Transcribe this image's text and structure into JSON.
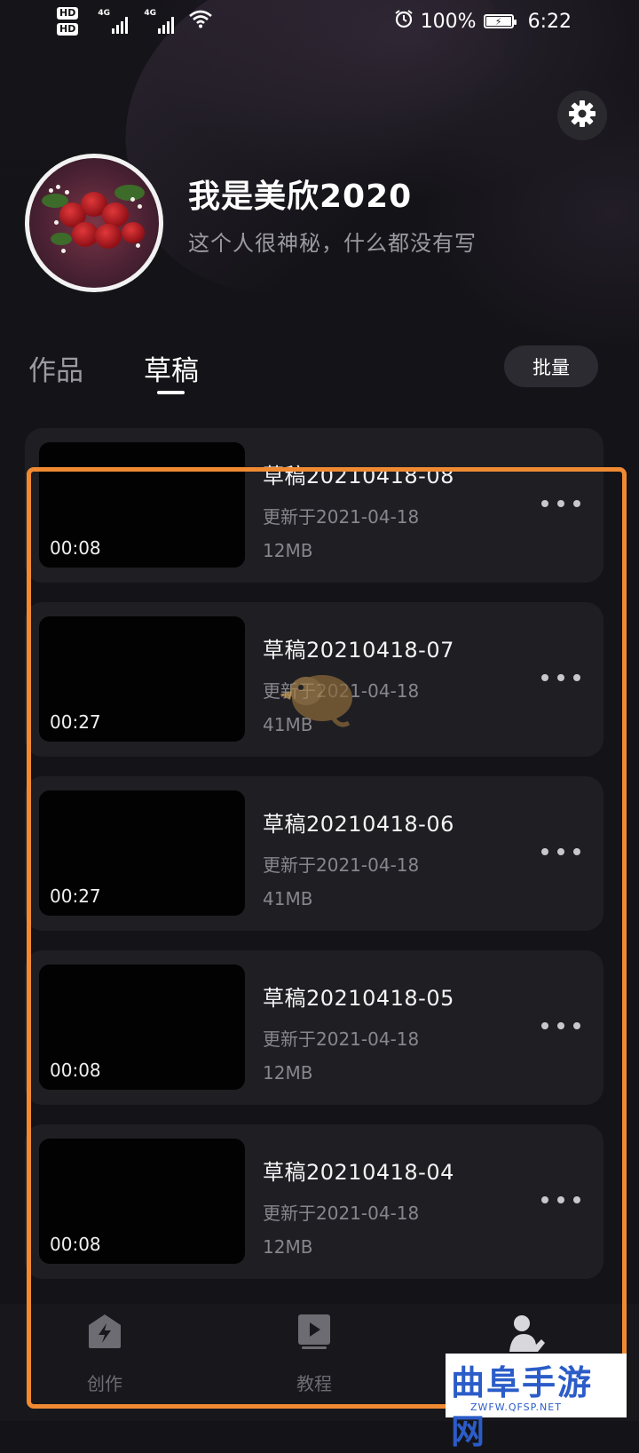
{
  "status_bar": {
    "hd1": "HD",
    "hd2": "HD",
    "net1": "4G",
    "net2": "4G",
    "battery_text": "100%",
    "time": "6:22"
  },
  "profile": {
    "username": "我是美欣2020",
    "bio": "这个人很神秘，什么都没有写"
  },
  "tabs": [
    {
      "label": "作品",
      "active": false
    },
    {
      "label": "草稿",
      "active": true
    }
  ],
  "batch_label": "批量",
  "drafts": [
    {
      "title": "草稿20210418-08",
      "updated": "更新于2021-04-18",
      "size": "12MB",
      "duration": "00:08"
    },
    {
      "title": "草稿20210418-07",
      "updated": "更新于2021-04-18",
      "size": "41MB",
      "duration": "00:27"
    },
    {
      "title": "草稿20210418-06",
      "updated": "更新于2021-04-18",
      "size": "41MB",
      "duration": "00:27"
    },
    {
      "title": "草稿20210418-05",
      "updated": "更新于2021-04-18",
      "size": "12MB",
      "duration": "00:08"
    },
    {
      "title": "草稿20210418-04",
      "updated": "更新于2021-04-18",
      "size": "12MB",
      "duration": "00:08"
    }
  ],
  "nav": {
    "create": "创作",
    "tutorial": "教程"
  },
  "watermark": {
    "main": "曲阜手游网",
    "sub": "ZWFW.QFSP.NET"
  },
  "colors": {
    "background": "#141418",
    "card": "#1e1e23",
    "highlight": "#f08a32",
    "muted_text": "#86868c"
  },
  "icons": [
    "gear-icon",
    "more-icon",
    "create-icon",
    "tutorial-icon",
    "me-icon",
    "battery-icon",
    "alarm-icon",
    "wifi-icon"
  ]
}
